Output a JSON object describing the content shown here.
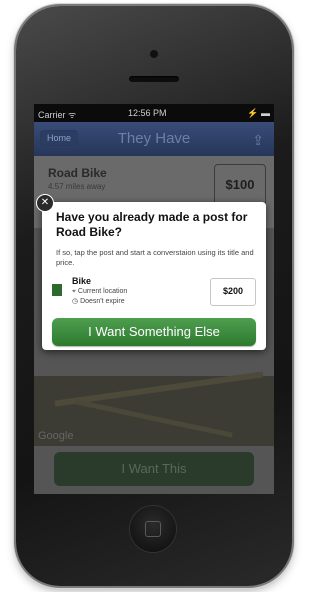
{
  "status_bar": {
    "carrier": "Carrier ᯤ",
    "time": "12:56 PM",
    "battery": "⚡ ▬"
  },
  "nav": {
    "back": "Home",
    "title": "They Have"
  },
  "listing": {
    "title": "Road Bike",
    "distance": "4.57 miles away",
    "price": "$100"
  },
  "map": {
    "logo": "Google"
  },
  "bottom_button": "I Want This",
  "dialog": {
    "title": "Have you already made a post for Road Bike?",
    "text": "If so, tap the post and start a converstaion using its title and price.",
    "post": {
      "title": "Bike",
      "location": "Current location",
      "expiry": "Doesn't expire",
      "price": "$200"
    },
    "primary_button": "I Want Something Else"
  },
  "colors": {
    "primary_green": "#2d7a2f",
    "nav_blue": "#2b3d63"
  },
  "icons": {
    "close": "close-icon",
    "share": "share-icon",
    "pin": "location-pin-icon",
    "clock": "clock-icon"
  }
}
